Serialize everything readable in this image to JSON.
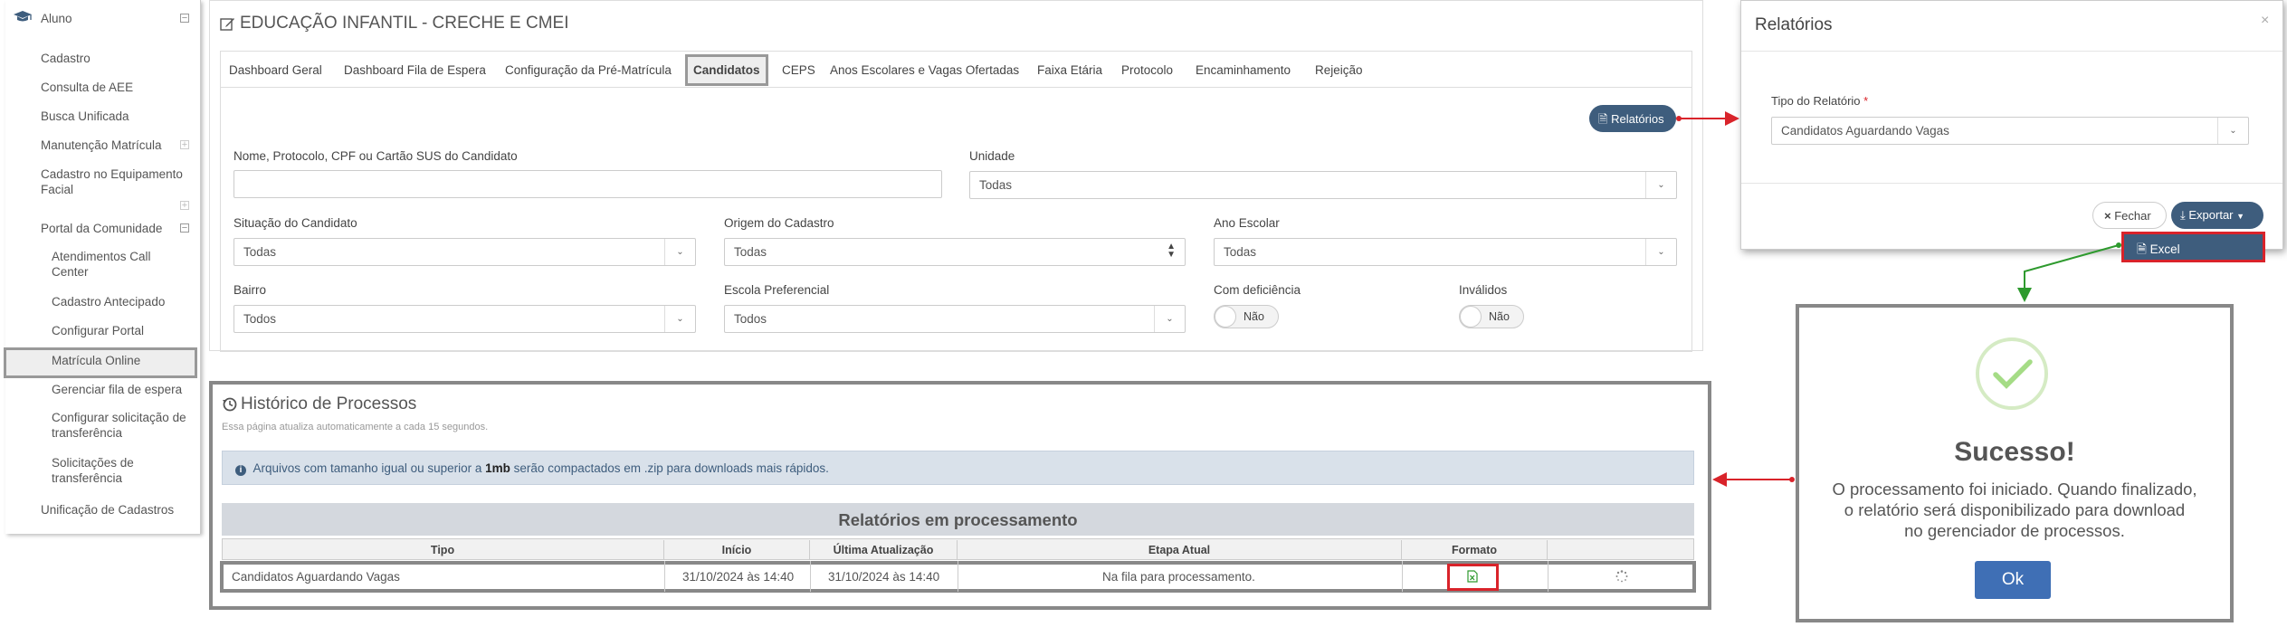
{
  "sidebar": {
    "section": "Aluno",
    "items": [
      {
        "label": "Cadastro"
      },
      {
        "label": "Consulta de AEE"
      },
      {
        "label": "Busca Unificada"
      },
      {
        "label": "Manutenção Matrícula"
      },
      {
        "label": "Cadastro no Equipamento Facial"
      },
      {
        "label": "Portal da Comunidade"
      },
      {
        "label": "Atendimentos Call Center"
      },
      {
        "label": "Cadastro Antecipado"
      },
      {
        "label": "Configurar Portal"
      },
      {
        "label": "Matrícula Online"
      },
      {
        "label": "Gerenciar fila de espera"
      },
      {
        "label": "Configurar solicitação de transferência"
      },
      {
        "label": "Solicitações de transferência"
      },
      {
        "label": "Unificação de Cadastros"
      }
    ]
  },
  "page": {
    "title": "EDUCAÇÃO INFANTIL - CRECHE E CMEI"
  },
  "tabs": [
    "Dashboard Geral",
    "Dashboard Fila de Espera",
    "Configuração da Pré-Matrícula",
    "Candidatos",
    "CEPS",
    "Anos Escolares e Vagas Ofertadas",
    "Faixa Etária",
    "Protocolo",
    "Encaminhamento",
    "Rejeição"
  ],
  "form": {
    "relatorios_button": "Relatórios",
    "nome_label": "Nome, Protocolo, CPF ou Cartão SUS do Candidato",
    "nome_value": "",
    "unidade_label": "Unidade",
    "unidade_value": "Todas",
    "situacao_label": "Situação do Candidato",
    "situacao_value": "Todas",
    "origem_label": "Origem do Cadastro",
    "origem_value": "Todas",
    "ano_label": "Ano Escolar",
    "ano_value": "Todas",
    "bairro_label": "Bairro",
    "bairro_value": "Todos",
    "escola_label": "Escola Preferencial",
    "escola_value": "Todos",
    "deficiencia_label": "Com deficiência",
    "deficiencia_value": "Não",
    "invalidos_label": "Inválidos",
    "invalidos_value": "Não"
  },
  "modal_relatorios": {
    "title": "Relatórios",
    "close": "×",
    "tipo_label": "Tipo do Relatório",
    "required_mark": "*",
    "tipo_value": "Candidatos Aguardando Vagas",
    "fechar_button": "Fechar",
    "exportar_button": "Exportar",
    "excel_option": "Excel"
  },
  "historico": {
    "title": "Histórico de Processos",
    "subtitle": "Essa página atualiza automaticamente a cada 15 segundos.",
    "info_pre": "Arquivos com tamanho igual ou superior a ",
    "info_bold": "1mb",
    "info_post": " serão compactados em .zip para downloads mais rápidos.",
    "table_title": "Relatórios em processamento",
    "columns": [
      "Tipo",
      "Início",
      "Última Atualização",
      "Etapa Atual",
      "Formato",
      ""
    ],
    "rows": [
      {
        "tipo": "Candidatos Aguardando Vagas",
        "inicio": "31/10/2024 às 14:40",
        "ultima": "31/10/2024 às 14:40",
        "etapa": "Na fila para processamento."
      }
    ]
  },
  "success_modal": {
    "title": "Sucesso!",
    "message_line1": "O processamento foi iniciado. Quando finalizado,",
    "message_line2": "o relatório será disponibilizado para download",
    "message_line3": "no gerenciador de processos.",
    "ok_button": "Ok"
  },
  "colors": {
    "primary": "#3e5d7d",
    "annotation_red": "#d9232a",
    "annotation_green": "#2e9a2e",
    "success_check": "#a5dc86",
    "ok_button": "#3f6fb5"
  }
}
